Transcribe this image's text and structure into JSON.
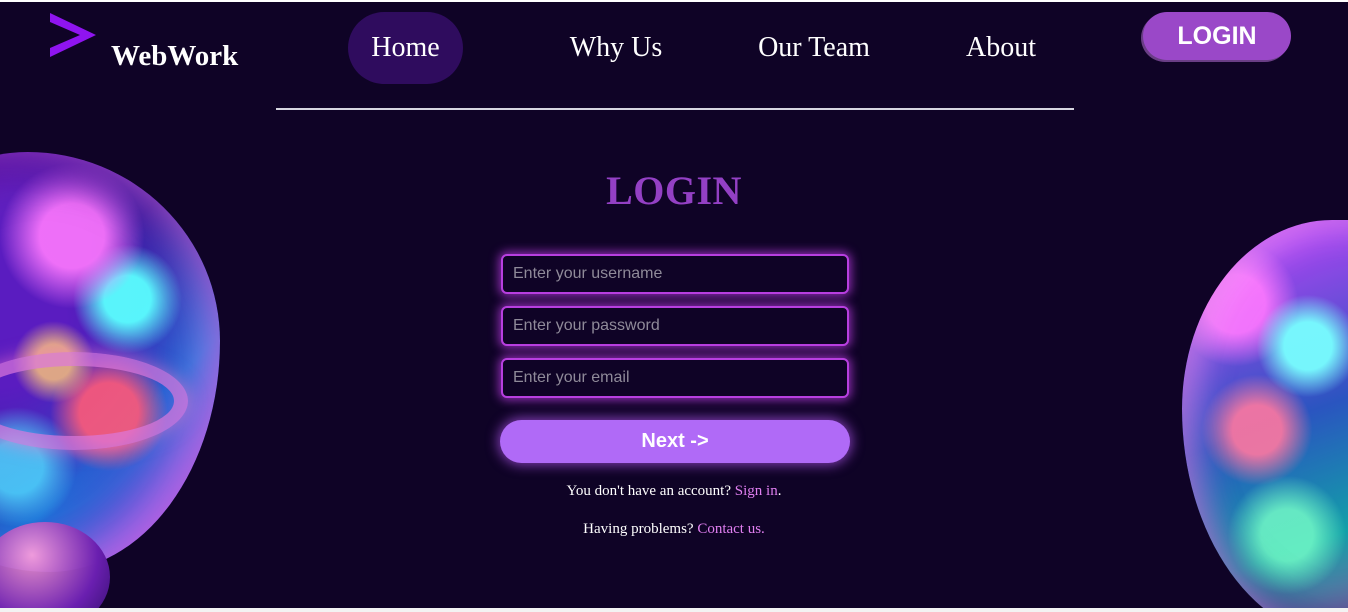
{
  "colors": {
    "background": "#0f0326",
    "accent": "#9340c4",
    "button": "#b06af7",
    "link": "#e07ff0"
  },
  "brand": {
    "name": "WebWork",
    "icon": "chevron-right-logo"
  },
  "nav": {
    "items": [
      {
        "label": "Home",
        "active": true
      },
      {
        "label": "Why Us"
      },
      {
        "label": "Our Team"
      },
      {
        "label": "About"
      }
    ],
    "login_label": "LOGIN"
  },
  "form": {
    "title": "LOGIN",
    "username_placeholder": "Enter your username",
    "password_placeholder": "Enter your password",
    "email_placeholder": "Enter your email",
    "next_label": "Next ->",
    "no_account_text": "You don't have an account?",
    "sign_in_link": "Sign in",
    "sign_in_suffix": ".",
    "problems_text": "Having problems?",
    "contact_link": "Contact us."
  }
}
